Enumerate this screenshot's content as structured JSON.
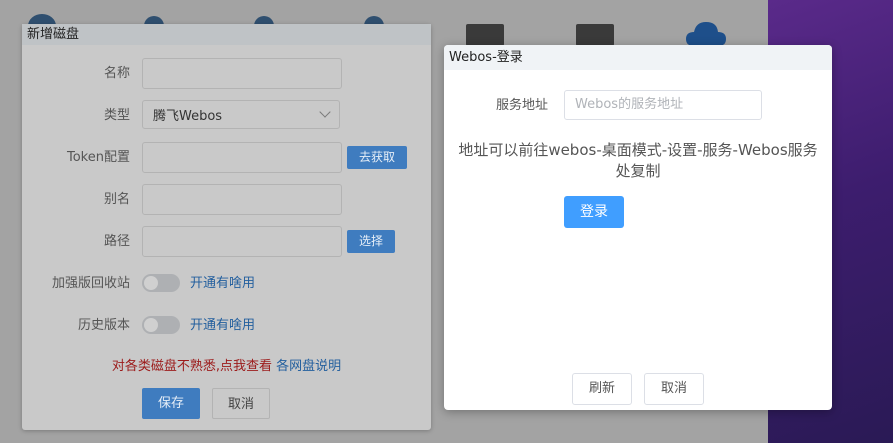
{
  "add_disk_dialog": {
    "title": "新增磁盘",
    "fields": {
      "name_label": "名称",
      "type_label": "类型",
      "type_value": "腾飞Webos",
      "token_label": "Token配置",
      "token_button": "去获取",
      "alias_label": "别名",
      "path_label": "路径",
      "path_button": "选择",
      "recycle_label": "加强版回收站",
      "recycle_link": "开通有啥用",
      "history_label": "历史版本",
      "history_link": "开通有啥用"
    },
    "hint_red": "对各类磁盘不熟悉,点我查看",
    "hint_link": "各网盘说明",
    "save_label": "保存",
    "cancel_label": "取消",
    "recycle_enabled": false,
    "history_enabled": false
  },
  "webos_login_dialog": {
    "title": "Webos-登录",
    "service_label": "服务地址",
    "service_placeholder": "Webos的服务地址",
    "note": "地址可以前往webos-桌面模式-设置-服务-Webos服务处复制",
    "login_label": "登录",
    "refresh_label": "刷新",
    "cancel_label": "取消"
  },
  "colors": {
    "primary": "#409eff",
    "link": "#235f9e",
    "warning_text": "#9c1a1a"
  }
}
